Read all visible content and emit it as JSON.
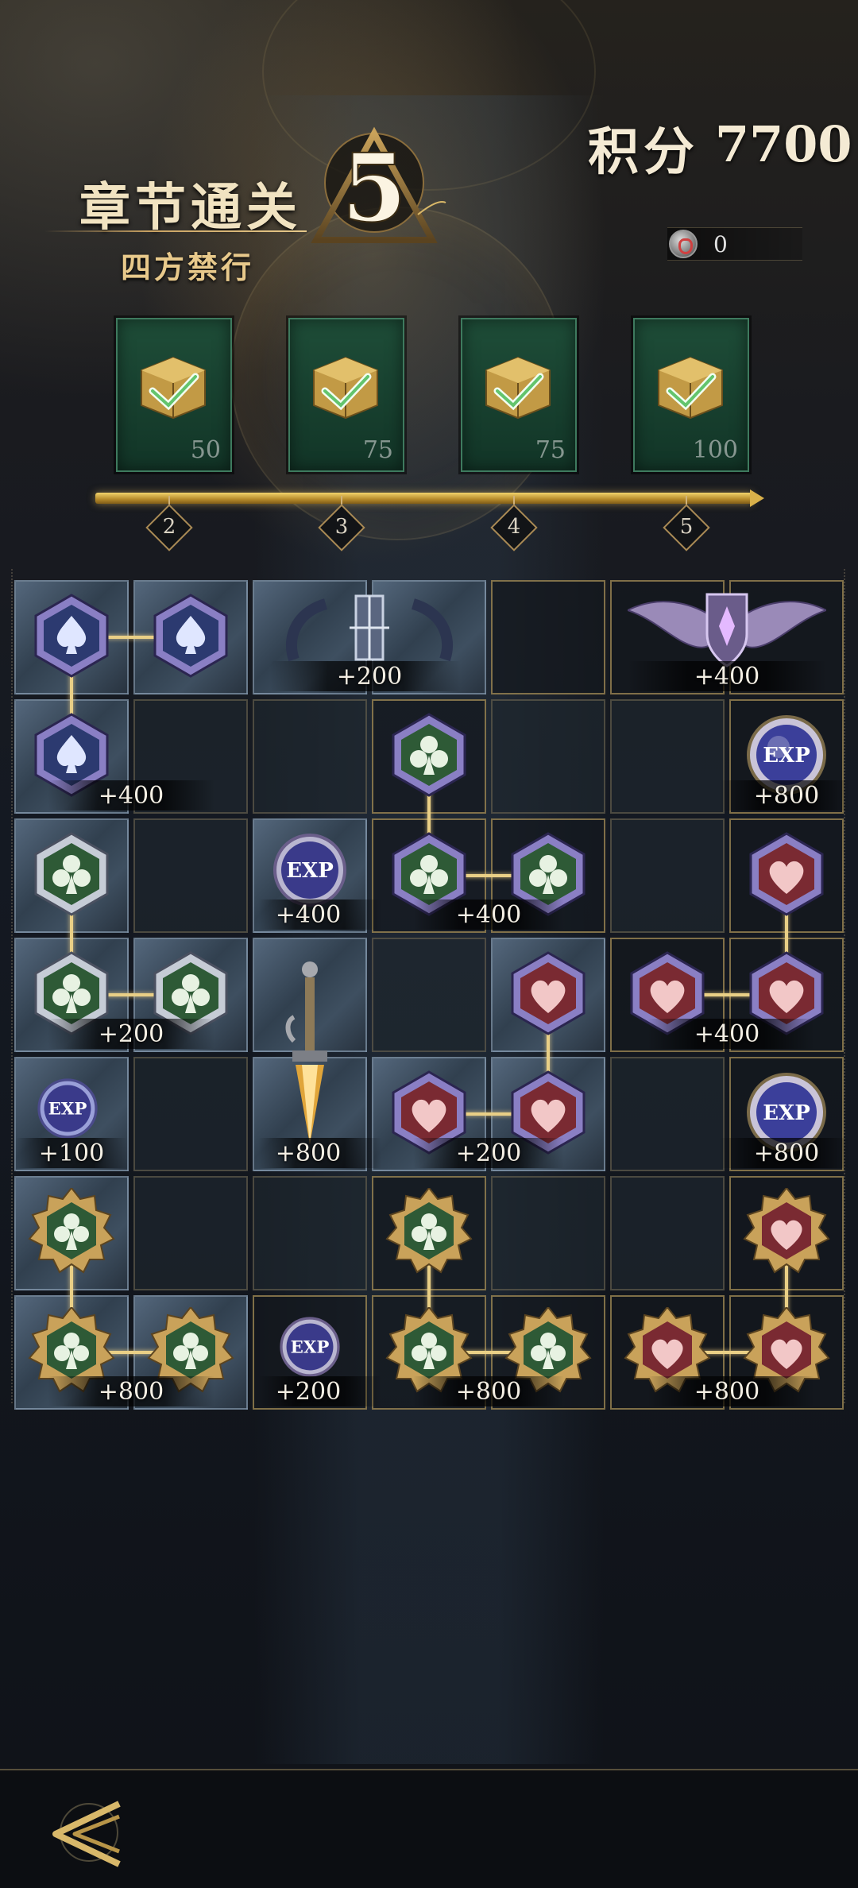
{
  "header": {
    "chapter_title": "章节通关",
    "chapter_subtitle": "四方禁行",
    "chapter_number": "5",
    "score_label": "积分",
    "score_value": "7700",
    "currency_icon": "ticket-coin-icon",
    "currency_value": "0"
  },
  "rewards": [
    {
      "count": "50",
      "claimed": true,
      "threshold": "2"
    },
    {
      "count": "75",
      "claimed": true,
      "threshold": "3"
    },
    {
      "count": "75",
      "claimed": true,
      "threshold": "4"
    },
    {
      "count": "100",
      "claimed": true,
      "threshold": "5"
    }
  ],
  "grid": {
    "labels": {
      "r0_wreath": "+200",
      "r0_wings": "+400",
      "r1_spade": "+400",
      "r1_exp": "+800",
      "r2_exp": "+400",
      "r2_club": "+400",
      "r3_club": "+200",
      "r3_heart": "+400",
      "r4_exp": "+100",
      "r4_sword": "+800",
      "r4_heart": "+200",
      "r4_exp_right": "+800",
      "r6_club": "+800",
      "r6_exp": "+200",
      "r6_club_mid": "+800",
      "r6_heart": "+800"
    },
    "exp_text": "EXP"
  },
  "colors": {
    "accent_gold": "#e9cf86",
    "club_green": "#2e5a36",
    "heart_red": "#7a2a32",
    "spade_blue": "#2c3a70"
  },
  "footer": {
    "back_icon": "back-arrow-icon"
  }
}
